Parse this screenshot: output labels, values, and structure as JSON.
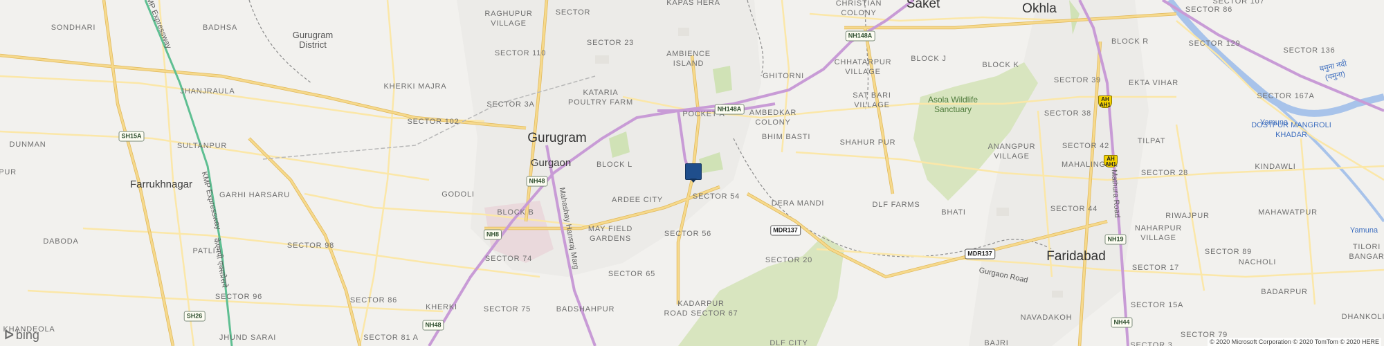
{
  "map": {
    "attribution": "© 2020 Microsoft Corporation © 2020 TomTom © 2020 HERE",
    "logo_text": "bing",
    "pin_color": "#1f4e8c",
    "colors": {
      "land": "#f2f1ee",
      "park": "#d8e5bf",
      "road_major": "#f6d98c",
      "road_casing": "#e0b85a",
      "expressway": "#c89bd6",
      "water": "#a8c3ea"
    },
    "places": {
      "sondhari": "SONDHARI",
      "badhsa": "BADHSA",
      "raghupur": "RAGHUPUR\nVILLAGE",
      "sector_top": "SECTOR",
      "kapas_hera": "KAPAS HERA",
      "gurugram_district": "Gurugram\nDistrict",
      "sector_23": "SECTOR 23",
      "sector_110": "SECTOR 110",
      "ambience_island": "AMBIENCE\nISLAND",
      "jhanjraula": "JHANJRAULA",
      "kherki_majra": "KHERKI MAJRA",
      "kataria": "KATARIA\nPOULTRY FARM",
      "sector_3a": "SECTOR 3A",
      "sector_102": "SECTOR 102",
      "pocket_a": "POCKET A",
      "gurugram": "Gurugram",
      "gurgaon": "Gurgaon",
      "dunman": "DUNMAN",
      "sultanpur": "SULTANPUR",
      "block_l": "BLOCK L",
      "farrukhnagar": "Farrukhnagar",
      "garhi_harsaru": "GARHI HARSARU",
      "godoli": "GODOLI",
      "ardee_city": "ARDEE CITY",
      "sector_54": "SECTOR 54",
      "block_b": "BLOCK B",
      "may_field": "MAY FIELD\nGARDENS",
      "sector_56": "SECTOR 56",
      "daboda": "DABODA",
      "sector_98": "SECTOR 98",
      "sector_74": "SECTOR 74",
      "patli": "PATLI",
      "sector_65": "SECTOR 65",
      "sector_96": "SECTOR 96",
      "sector_86": "SECTOR 86",
      "kherki": "KHERKI",
      "sector_75": "SECTOR 75",
      "badshahpur": "BADSHAHPUR",
      "kadarpur": "KADARPUR\nROAD SECTOR 67",
      "khandeola": "KHANDEOLA",
      "jhund_sarai": "JHUND SARAI",
      "sector_81a": "SECTOR 81 A",
      "pur_left": "PUR",
      "christian_colony": "CHRISTIAN\nCOLONY",
      "saket": "Saket",
      "chhatarpur": "CHHATARPUR\nVILLAGE",
      "block_j": "BLOCK J",
      "ghitorni": "GHITORNI",
      "ambedkar_colony": "AMBEDKAR\nCOLONY",
      "sat_bari": "SAT BARI\nVILLAGE",
      "shahur_pur": "SHAHUR PUR",
      "bhim_basti": "BHIM BASTI",
      "dera_mandi": "DERA MANDI",
      "dlf_farms": "DLF FARMS",
      "bhati": "BHATI",
      "sector_20": "SECTOR 20",
      "dlf_city": "DLF CITY",
      "bajri": "BAJRI",
      "okhla": "Okhla",
      "block_k": "BLOCK K",
      "block_r": "BLOCK R",
      "sector_107": "SECTOR 107",
      "sector_86_right": "SECTOR 86",
      "sector_129": "SECTOR 129",
      "sector_136": "SECTOR 136",
      "sector_39": "SECTOR 39",
      "ekta_vihar": "EKTA VIHAR",
      "sector_167a": "SECTOR 167A",
      "sector_38": "SECTOR 38",
      "asola": "Asola Wildlife\nSanctuary",
      "anangpur": "ANANGPUR\nVILLAGE",
      "sector_42": "SECTOR 42",
      "tilpat": "TILPAT",
      "yamuna_top": "Yamuna",
      "dostpur": "DOSTPUR MANGROLI KHADAR",
      "mahalingam": "MAHALINGAM",
      "kindawli": "KINDAWLI",
      "sector_28": "SECTOR 28",
      "sector_44": "SECTOR 44",
      "riwajpur": "RIWAJPUR",
      "mahawatpur": "MAHAWATPUR",
      "naharpur": "NAHARPUR\nVILLAGE",
      "yamuna_right": "Yamuna",
      "faridabad": "Faridabad",
      "sector_89": "SECTOR 89",
      "tilori": "TILORI\nBANGAR",
      "nacholi": "NACHOLI",
      "sector_17": "SECTOR 17",
      "sector_15a": "SECTOR 15A",
      "badarpur": "BADARPUR",
      "navadakoh": "NAVADAKOH",
      "sector_79": "SECTOR 79",
      "dhankoli": "DHANKOLI",
      "sector_3": "SECTOR 3",
      "gurgaon_road": "Gurgaon Road",
      "mathura_road": "Mathura Road",
      "kmp_exp_top": "KMP Expressway",
      "kmp_exp_mid": "KMP Expressway",
      "kmp_hindi": "केएमपी एक्सप्रेसवे",
      "hanuman_marg": "Mahashay Hansraj Marg",
      "yamuna_hindi": "यमुना नदी (यमुना)"
    },
    "shields": {
      "sh15a": "SH15A",
      "nh48_a": "NH48",
      "nh8": "NH8",
      "sh26": "SH26",
      "nh48_b": "NH48",
      "nh148a_top": "NH148A",
      "nh148a_mid": "NH148A",
      "mdr137_a": "MDR137",
      "mdr137_b": "MDR137",
      "nh19": "NH19",
      "nh44": "NH44",
      "ah1_a": "AH\nAH1",
      "ah1_b": "AH\nAH1"
    }
  }
}
